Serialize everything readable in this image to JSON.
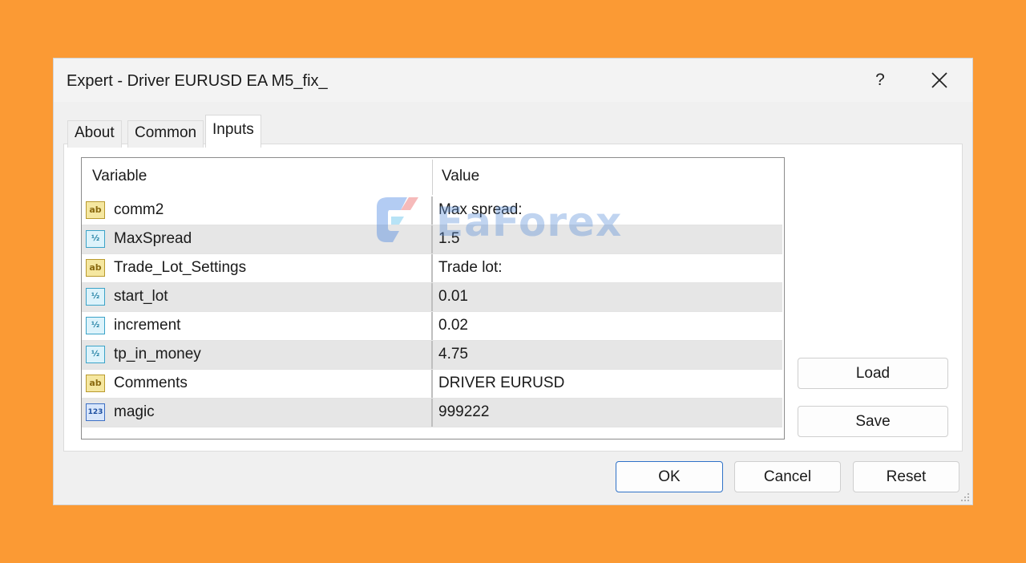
{
  "dialog": {
    "title": "Expert - Driver EURUSD EA M5_fix_",
    "help_label": "?",
    "close_icon": "close-icon"
  },
  "tabs": [
    {
      "label": "About"
    },
    {
      "label": "Common"
    },
    {
      "label": "Inputs",
      "active": true
    }
  ],
  "grid": {
    "columns": [
      "Variable",
      "Value"
    ],
    "rows": [
      {
        "icon": "ab",
        "type": "string",
        "variable": "comm2",
        "value": "Max spread:"
      },
      {
        "icon": "½",
        "type": "double",
        "variable": "MaxSpread",
        "value": "1.5"
      },
      {
        "icon": "ab",
        "type": "string",
        "variable": "Trade_Lot_Settings",
        "value": "Trade lot:"
      },
      {
        "icon": "½",
        "type": "double",
        "variable": "start_lot",
        "value": "0.01"
      },
      {
        "icon": "½",
        "type": "double",
        "variable": "increment",
        "value": "0.02"
      },
      {
        "icon": "½",
        "type": "double",
        "variable": "tp_in_money",
        "value": "4.75"
      },
      {
        "icon": "ab",
        "type": "string",
        "variable": "Comments",
        "value": "DRIVER EURUSD"
      },
      {
        "icon": "123",
        "type": "integer",
        "variable": "magic",
        "value": "999222"
      }
    ]
  },
  "side_buttons": {
    "load": "Load",
    "save": "Save"
  },
  "footer_buttons": {
    "ok": "OK",
    "cancel": "Cancel",
    "reset": "Reset"
  },
  "watermark": {
    "text": "EaForex"
  },
  "colors": {
    "background": "#FB9A34",
    "dialog": "#F0F0F0",
    "row_alt": "#E6E6E6",
    "ok_border": "#2F72C8"
  }
}
